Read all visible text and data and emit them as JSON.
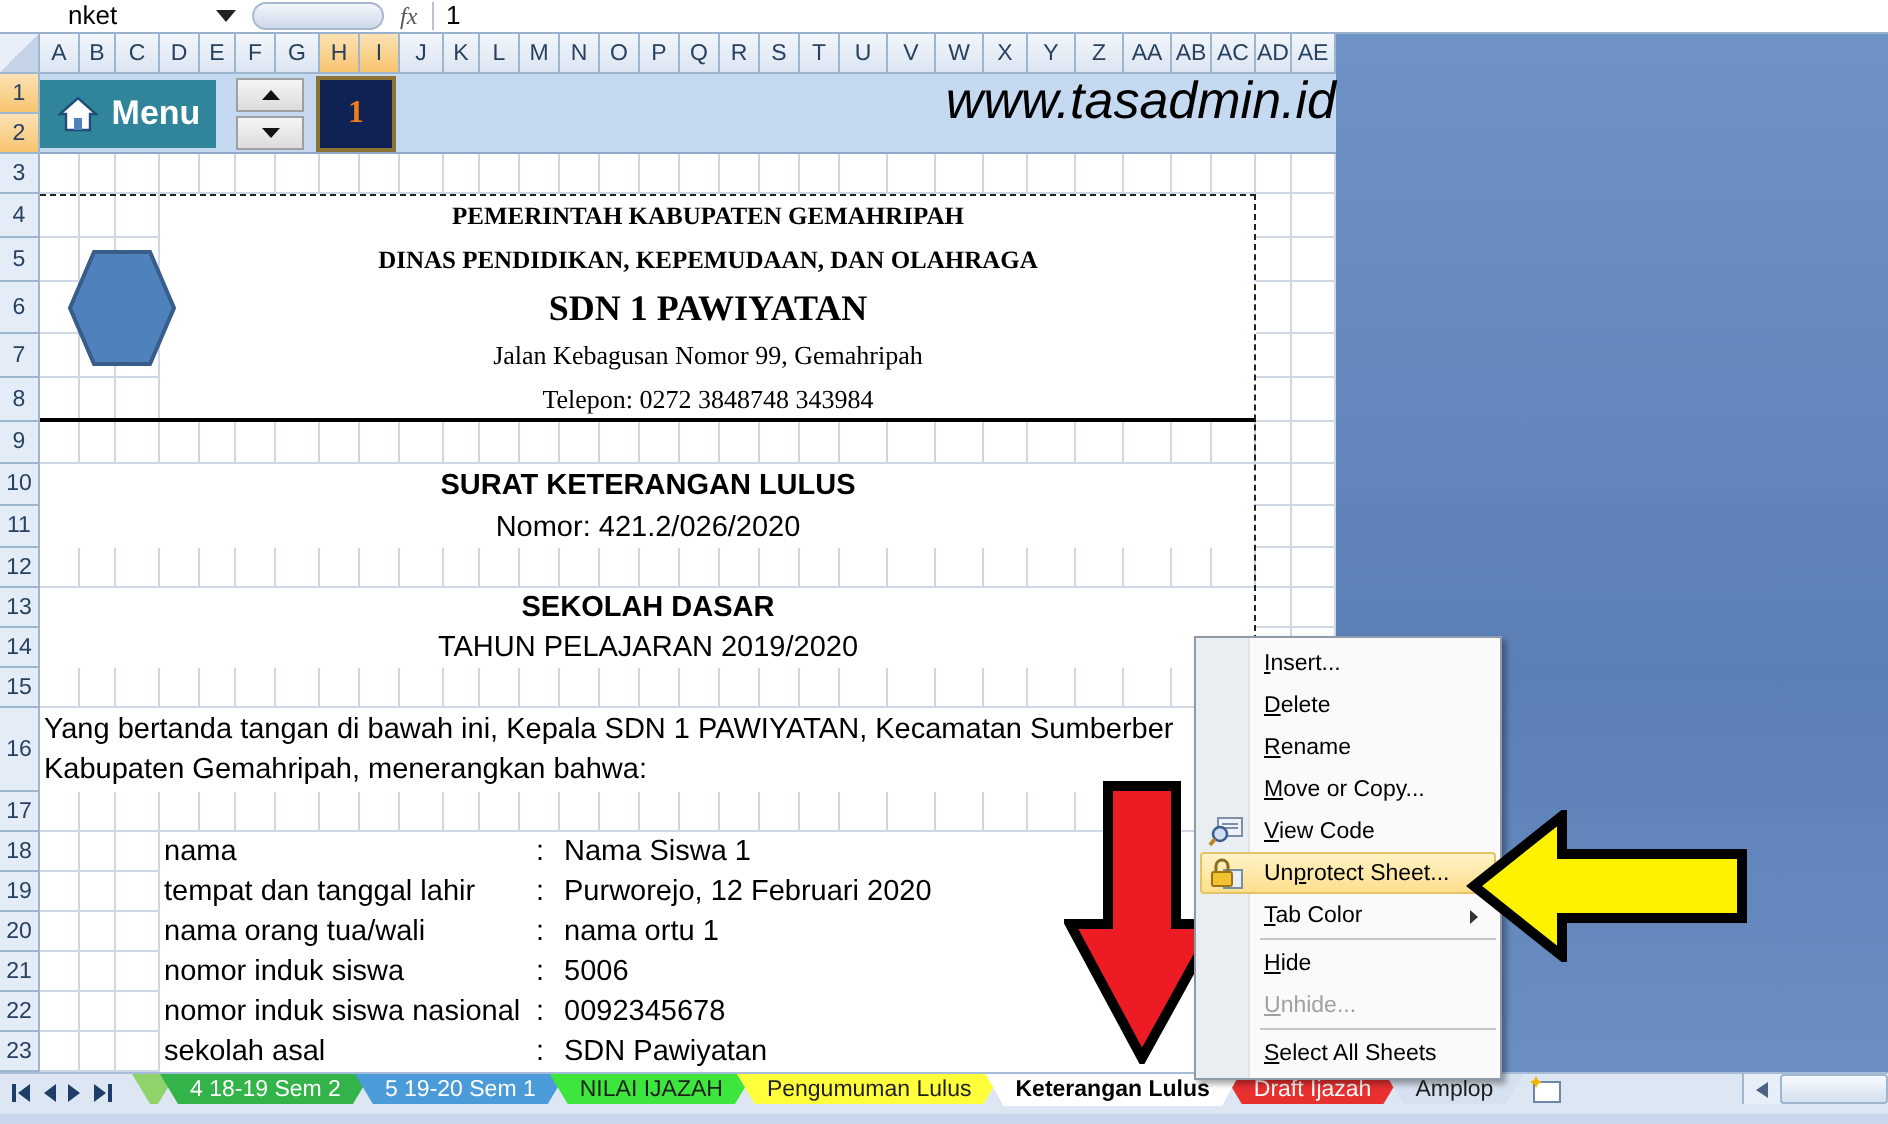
{
  "formula_bar": {
    "name_box": "nket",
    "function_label": "fx",
    "formula": "1"
  },
  "column_headers": [
    {
      "label": "A",
      "selected": false
    },
    {
      "label": "B",
      "selected": false
    },
    {
      "label": "C",
      "selected": false
    },
    {
      "label": "D",
      "selected": false
    },
    {
      "label": "E",
      "selected": false
    },
    {
      "label": "F",
      "selected": false
    },
    {
      "label": "G",
      "selected": false
    },
    {
      "label": "H",
      "selected": true
    },
    {
      "label": "I",
      "selected": true
    },
    {
      "label": "J",
      "selected": false
    },
    {
      "label": "K",
      "selected": false
    },
    {
      "label": "L",
      "selected": false
    },
    {
      "label": "M",
      "selected": false
    },
    {
      "label": "N",
      "selected": false
    },
    {
      "label": "O",
      "selected": false
    },
    {
      "label": "P",
      "selected": false
    },
    {
      "label": "Q",
      "selected": false
    },
    {
      "label": "R",
      "selected": false
    },
    {
      "label": "S",
      "selected": false
    },
    {
      "label": "T",
      "selected": false
    },
    {
      "label": "U",
      "selected": false
    },
    {
      "label": "V",
      "selected": false
    },
    {
      "label": "W",
      "selected": false
    },
    {
      "label": "X",
      "selected": false
    },
    {
      "label": "Y",
      "selected": false
    },
    {
      "label": "Z",
      "selected": false
    },
    {
      "label": "AA",
      "selected": false
    },
    {
      "label": "AB",
      "selected": false
    },
    {
      "label": "AC",
      "selected": false
    },
    {
      "label": "AD",
      "selected": false
    },
    {
      "label": "AE",
      "selected": false
    }
  ],
  "row_headers": [
    {
      "label": "1",
      "selected": true
    },
    {
      "label": "2",
      "selected": true
    },
    {
      "label": "3",
      "selected": false
    },
    {
      "label": "4",
      "selected": false
    },
    {
      "label": "5",
      "selected": false
    },
    {
      "label": "6",
      "selected": false
    },
    {
      "label": "7",
      "selected": false
    },
    {
      "label": "8",
      "selected": false
    },
    {
      "label": "9",
      "selected": false
    },
    {
      "label": "10",
      "selected": false
    },
    {
      "label": "11",
      "selected": false
    },
    {
      "label": "12",
      "selected": false
    },
    {
      "label": "13",
      "selected": false
    },
    {
      "label": "14",
      "selected": false
    },
    {
      "label": "15",
      "selected": false
    },
    {
      "label": "16",
      "selected": false
    },
    {
      "label": "17",
      "selected": false
    },
    {
      "label": "18",
      "selected": false
    },
    {
      "label": "19",
      "selected": false
    },
    {
      "label": "20",
      "selected": false
    },
    {
      "label": "21",
      "selected": false
    },
    {
      "label": "22",
      "selected": false
    },
    {
      "label": "23",
      "selected": false
    }
  ],
  "header_band": {
    "menu_button": "Menu",
    "counter": "1",
    "website": "www.tasadmin.id"
  },
  "letterhead": [
    {
      "kind": "heading",
      "text": "PEMERINTAH KABUPATEN GEMAHRIPAH"
    },
    {
      "kind": "heading",
      "text": "DINAS PENDIDIKAN, KEPEMUDAAN, DAN OLAHRAGA"
    },
    {
      "kind": "name",
      "text": "SDN 1 PAWIYATAN"
    },
    {
      "kind": "detail",
      "text": "Jalan Kebagusan Nomor 99, Gemahripah"
    },
    {
      "kind": "detail",
      "text": "Telepon: 0272 3848748 343984"
    }
  ],
  "titles": [
    {
      "kind": "title",
      "text": "SURAT KETERANGAN LULUS"
    },
    {
      "kind": "subtitle",
      "text": "Nomor: 421.2/026/2020"
    },
    {
      "kind": "title",
      "text": "SEKOLAH DASAR"
    },
    {
      "kind": "subtitle",
      "text": "TAHUN PELAJARAN 2019/2020"
    }
  ],
  "paragraph_lines": [
    "Yang bertanda tangan di bawah ini, Kepala SDN 1 PAWIYATAN, Kecamatan Sumberber",
    "Kabupaten Gemahripah, menerangkan bahwa:"
  ],
  "fields": [
    {
      "label": "nama",
      "separator": ":",
      "value": "Nama Siswa 1"
    },
    {
      "label": "tempat dan tanggal lahir",
      "separator": ":",
      "value": "Purworejo, 12 Februari 2020"
    },
    {
      "label": "nama orang tua/wali",
      "separator": ":",
      "value": "nama ortu 1"
    },
    {
      "label": "nomor induk siswa",
      "separator": ":",
      "value": "5006"
    },
    {
      "label": "nomor induk siswa nasional",
      "separator": ":",
      "value": "0092345678"
    },
    {
      "label": "sekolah asal",
      "separator": ":",
      "value": "SDN Pawiyatan"
    }
  ],
  "sheet_tabs": [
    {
      "color": "#8fd36a",
      "selected": false
    },
    {
      "label": "4 18-19 Sem 2",
      "color": "#33b44a",
      "selected": false
    },
    {
      "label": "5 19-20 Sem 1",
      "color": "#4b9bd9",
      "selected": false
    },
    {
      "label": "NILAI IJAZAH",
      "color": "#3ce63c",
      "selected": false
    },
    {
      "label": "Pengumuman Lulus",
      "color": "#ffff3c",
      "selected": false
    },
    {
      "label": "Keterangan Lulus",
      "selected": true
    },
    {
      "label": "Draft Ijazah",
      "color": "#e8302f",
      "selected": false
    },
    {
      "label": "Amplop",
      "selected": false
    }
  ],
  "context_menu": {
    "groups": [
      [
        {
          "kind": "plain",
          "key": "I",
          "after": "nsert...",
          "disabled": false,
          "selected": false,
          "submenu": false
        },
        {
          "kind": "plain",
          "key": "D",
          "after": "elete",
          "disabled": false,
          "selected": false,
          "submenu": false
        },
        {
          "kind": "plain",
          "key": "R",
          "after": "ename",
          "disabled": false,
          "selected": false,
          "submenu": false
        },
        {
          "kind": "plain",
          "key": "M",
          "after": "ove or Copy...",
          "disabled": false,
          "selected": false,
          "submenu": false
        },
        {
          "kind": "code",
          "key": "V",
          "after": "iew Code",
          "disabled": false,
          "selected": false,
          "submenu": false
        },
        {
          "kind": "protect",
          "before": "Un",
          "key": "p",
          "after": "rotect Sheet...",
          "disabled": false,
          "selected": true,
          "submenu": false
        },
        {
          "kind": "plain",
          "key": "T",
          "after": "ab Color",
          "disabled": false,
          "selected": false,
          "submenu": true
        }
      ],
      [
        {
          "kind": "plain",
          "key": "H",
          "after": "ide",
          "disabled": false,
          "selected": false,
          "submenu": false
        },
        {
          "kind": "plain",
          "key": "U",
          "after": "nhide...",
          "disabled": true,
          "selected": false,
          "submenu": false
        }
      ],
      [
        {
          "kind": "plain",
          "key": "S",
          "after": "elect All Sheets",
          "disabled": false,
          "selected": false,
          "submenu": false
        }
      ]
    ]
  }
}
